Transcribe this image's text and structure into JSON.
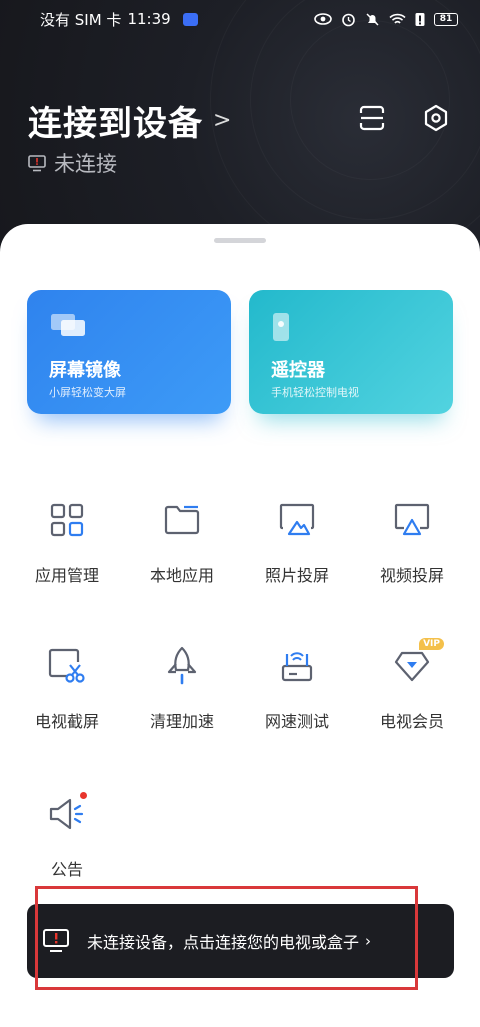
{
  "status_bar": {
    "carrier": "没有 SIM 卡",
    "time": "11:39",
    "battery": "81"
  },
  "header": {
    "title": "连接到设备",
    "connection_status": "未连接"
  },
  "cards": [
    {
      "title": "屏幕镜像",
      "subtitle": "小屏轻松变大屏"
    },
    {
      "title": "遥控器",
      "subtitle": "手机轻松控制电视"
    }
  ],
  "tools": [
    {
      "label": "应用管理",
      "icon": "apps-grid-icon"
    },
    {
      "label": "本地应用",
      "icon": "folder-icon"
    },
    {
      "label": "照片投屏",
      "icon": "photo-cast-icon"
    },
    {
      "label": "视频投屏",
      "icon": "video-cast-icon"
    },
    {
      "label": "电视截屏",
      "icon": "screenshot-scissors-icon"
    },
    {
      "label": "清理加速",
      "icon": "rocket-icon"
    },
    {
      "label": "网速测试",
      "icon": "router-icon"
    },
    {
      "label": "电视会员",
      "icon": "diamond-vip-icon",
      "badge": "VIP"
    },
    {
      "label": "公告",
      "icon": "megaphone-icon"
    }
  ],
  "banner": {
    "text": "未连接设备，点击连接您的电视或盒子",
    "chevron": "›"
  },
  "colors": {
    "header_bg": "#1b1d24",
    "mirror_card": "#2f83ee",
    "remote_card": "#23b9cc",
    "icon_stroke": "#5d6270",
    "icon_accent": "#2f7df0",
    "highlight_box": "#d9383a"
  }
}
